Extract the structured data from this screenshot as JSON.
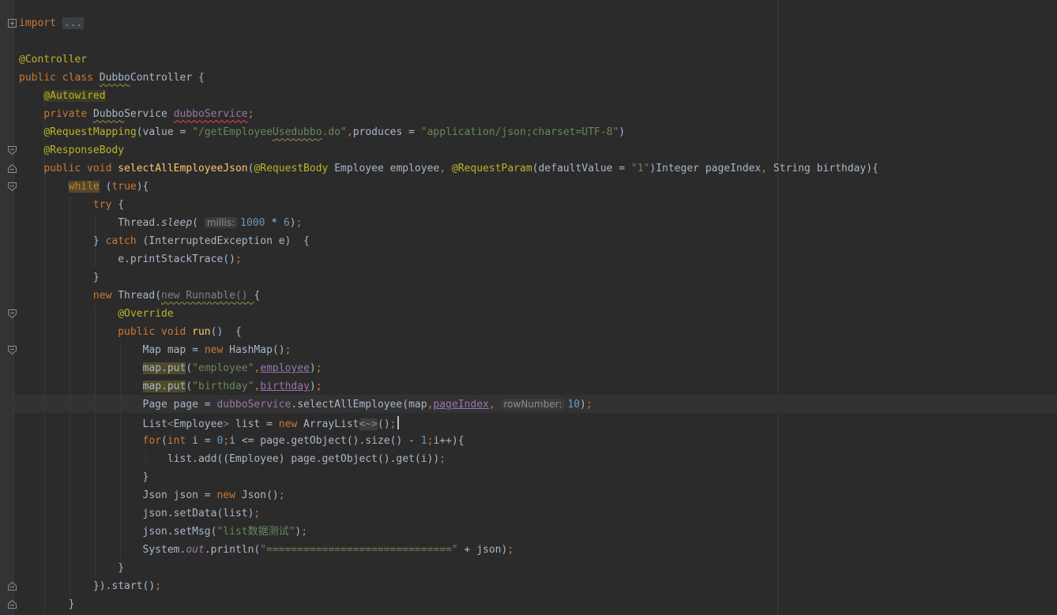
{
  "editor": {
    "colors": {
      "background": "#2b2b2b",
      "keyword": "#cc7832",
      "annotation": "#bbb529",
      "string": "#6a8759",
      "number": "#6897bb",
      "field": "#9876aa",
      "method_decl": "#ffc66d",
      "text": "#a9b7c6"
    },
    "current_line": 22,
    "lines": [
      {
        "tokens": [
          {
            "t": "import",
            "c": "kw"
          },
          {
            "t": " "
          },
          {
            "t": "...",
            "c": "fold-chip"
          }
        ]
      },
      {
        "tokens": []
      },
      {
        "tokens": [
          {
            "t": "@Controller",
            "c": "an"
          }
        ]
      },
      {
        "tokens": [
          {
            "t": "public class ",
            "c": "kw"
          },
          {
            "t": "Dubbo",
            "c": "squig"
          },
          {
            "t": "Controller {"
          }
        ]
      },
      {
        "tokens": [
          {
            "t": "    "
          },
          {
            "t": "@Autowired",
            "c": "an-bg"
          }
        ]
      },
      {
        "tokens": [
          {
            "t": "    "
          },
          {
            "t": "private ",
            "c": "kw"
          },
          {
            "t": "Dubbo",
            "c": "squig"
          },
          {
            "t": "Service "
          },
          {
            "t": "dubboService",
            "c": "fld squig-r"
          },
          {
            "t": ";",
            "c": "semi"
          }
        ]
      },
      {
        "tokens": [
          {
            "t": "    "
          },
          {
            "t": "@RequestMapping",
            "c": "an"
          },
          {
            "t": "(value = "
          },
          {
            "t": "\"/getEmployee",
            "c": "str"
          },
          {
            "t": "Usedubbo",
            "c": "str squig"
          },
          {
            "t": ".do\"",
            "c": "str"
          },
          {
            "t": ",",
            "c": "semi"
          },
          {
            "t": "produces = "
          },
          {
            "t": "\"application/json;charset=UTF-8\"",
            "c": "str"
          },
          {
            "t": ")"
          }
        ]
      },
      {
        "tokens": [
          {
            "t": "    "
          },
          {
            "t": "@ResponseBody",
            "c": "an"
          }
        ]
      },
      {
        "tokens": [
          {
            "t": "    "
          },
          {
            "t": "public void ",
            "c": "kw"
          },
          {
            "t": "selectAllEmployeeJson",
            "c": "fn"
          },
          {
            "t": "("
          },
          {
            "t": "@RequestBody ",
            "c": "an"
          },
          {
            "t": "Employee employee"
          },
          {
            "t": ", ",
            "c": "semi"
          },
          {
            "t": "@RequestParam",
            "c": "an"
          },
          {
            "t": "(defaultValue = "
          },
          {
            "t": "\"1\"",
            "c": "str"
          },
          {
            "t": ")Integer pageIndex"
          },
          {
            "t": ", ",
            "c": "semi"
          },
          {
            "t": "String birthday){"
          }
        ]
      },
      {
        "tokens": [
          {
            "t": "        "
          },
          {
            "t": "while",
            "c": "kw hl-word"
          },
          {
            "t": " ("
          },
          {
            "t": "true",
            "c": "kw"
          },
          {
            "t": "){"
          }
        ]
      },
      {
        "tokens": [
          {
            "t": "            "
          },
          {
            "t": "try",
            "c": "kw"
          },
          {
            "t": " {"
          }
        ]
      },
      {
        "tokens": [
          {
            "t": "                Thread."
          },
          {
            "t": "sleep",
            "c": "it"
          },
          {
            "t": "( "
          },
          {
            "t": "millis:",
            "c": "hint"
          },
          {
            "t": "1000",
            "c": "num"
          },
          {
            "t": " * "
          },
          {
            "t": "6",
            "c": "num"
          },
          {
            "t": ")"
          },
          {
            "t": ";",
            "c": "semi"
          }
        ]
      },
      {
        "tokens": [
          {
            "t": "            } "
          },
          {
            "t": "catch",
            "c": "kw"
          },
          {
            "t": " (InterruptedException e)  {"
          }
        ]
      },
      {
        "tokens": [
          {
            "t": "                e.printStackTrace()"
          },
          {
            "t": ";",
            "c": "semi"
          }
        ]
      },
      {
        "tokens": [
          {
            "t": "            }"
          }
        ]
      },
      {
        "tokens": [
          {
            "t": "            "
          },
          {
            "t": "new",
            "c": "kw"
          },
          {
            "t": " Thread("
          },
          {
            "t": "new Runnable() ",
            "c": "grey squig"
          },
          {
            "t": "{"
          }
        ]
      },
      {
        "tokens": [
          {
            "t": "                "
          },
          {
            "t": "@Override",
            "c": "an"
          }
        ]
      },
      {
        "tokens": [
          {
            "t": "                "
          },
          {
            "t": "public void ",
            "c": "kw"
          },
          {
            "t": "run",
            "c": "fn"
          },
          {
            "t": "()  {"
          }
        ]
      },
      {
        "tokens": [
          {
            "t": "                    Map map = "
          },
          {
            "t": "new",
            "c": "kw"
          },
          {
            "t": " HashMap()"
          },
          {
            "t": ";",
            "c": "semi"
          }
        ]
      },
      {
        "tokens": [
          {
            "t": "                    "
          },
          {
            "t": "map.put",
            "c": "hl-word"
          },
          {
            "t": "("
          },
          {
            "t": "\"employee\"",
            "c": "str"
          },
          {
            "t": ",",
            "c": "semi"
          },
          {
            "t": "employee",
            "c": "fld-u"
          },
          {
            "t": ")"
          },
          {
            "t": ";",
            "c": "semi"
          }
        ]
      },
      {
        "tokens": [
          {
            "t": "                    "
          },
          {
            "t": "map.put",
            "c": "hl-word"
          },
          {
            "t": "("
          },
          {
            "t": "\"birthday\"",
            "c": "str"
          },
          {
            "t": ",",
            "c": "semi"
          },
          {
            "t": "birthday",
            "c": "fld-u"
          },
          {
            "t": ")"
          },
          {
            "t": ";",
            "c": "semi"
          }
        ]
      },
      {
        "tokens": [
          {
            "t": "                    Page page = "
          },
          {
            "t": "dubboService",
            "c": "fld"
          },
          {
            "t": ".selectAllEmployee(map"
          },
          {
            "t": ",",
            "c": "semi"
          },
          {
            "t": "pageIndex",
            "c": "fld-u"
          },
          {
            "t": ", ",
            "c": "semi"
          },
          {
            "t": "rowNumber:",
            "c": "hint"
          },
          {
            "t": "10",
            "c": "num"
          },
          {
            "t": ")"
          },
          {
            "t": ";",
            "c": "semi"
          }
        ]
      },
      {
        "tokens": [
          {
            "t": "                    List"
          },
          {
            "t": "<",
            "c": "grey"
          },
          {
            "t": "Employee"
          },
          {
            "t": ">",
            "c": "grey"
          },
          {
            "t": " list = "
          },
          {
            "t": "new",
            "c": "kw"
          },
          {
            "t": " ArrayList"
          },
          {
            "t": "<~>",
            "c": "diamond-chip"
          },
          {
            "t": "()"
          },
          {
            "t": ";",
            "c": "semi"
          }
        ]
      },
      {
        "tokens": [
          {
            "t": "                    "
          },
          {
            "t": "for",
            "c": "kw"
          },
          {
            "t": "("
          },
          {
            "t": "int",
            "c": "kw"
          },
          {
            "t": " i = "
          },
          {
            "t": "0",
            "c": "num"
          },
          {
            "t": ";",
            "c": "semi"
          },
          {
            "t": "i <= page.getObject().size() - "
          },
          {
            "t": "1",
            "c": "num"
          },
          {
            "t": ";",
            "c": "semi"
          },
          {
            "t": "i++){"
          }
        ]
      },
      {
        "tokens": [
          {
            "t": "                        list.add((Employee) page.getObject().get(i))"
          },
          {
            "t": ";",
            "c": "semi"
          }
        ]
      },
      {
        "tokens": [
          {
            "t": "                    }"
          }
        ]
      },
      {
        "tokens": [
          {
            "t": "                    Json json = "
          },
          {
            "t": "new",
            "c": "kw"
          },
          {
            "t": " Json()"
          },
          {
            "t": ";",
            "c": "semi"
          }
        ]
      },
      {
        "tokens": [
          {
            "t": "                    json.setData(list)"
          },
          {
            "t": ";",
            "c": "semi"
          }
        ]
      },
      {
        "tokens": [
          {
            "t": "                    json.setMsg("
          },
          {
            "t": "\"list数据测试\"",
            "c": "str"
          },
          {
            "t": ")"
          },
          {
            "t": ";",
            "c": "semi"
          }
        ]
      },
      {
        "tokens": [
          {
            "t": "                    System."
          },
          {
            "t": "out",
            "c": "fld-it"
          },
          {
            "t": ".println("
          },
          {
            "t": "\"==============================\"",
            "c": "str"
          },
          {
            "t": " + json)"
          },
          {
            "t": ";",
            "c": "semi"
          }
        ]
      },
      {
        "tokens": [
          {
            "t": "                }"
          }
        ]
      },
      {
        "tokens": [
          {
            "t": "            })."
          },
          {
            "t": "start()"
          },
          {
            "t": ";",
            "c": "semi"
          }
        ]
      },
      {
        "tokens": [
          {
            "t": "        }"
          }
        ]
      }
    ]
  }
}
